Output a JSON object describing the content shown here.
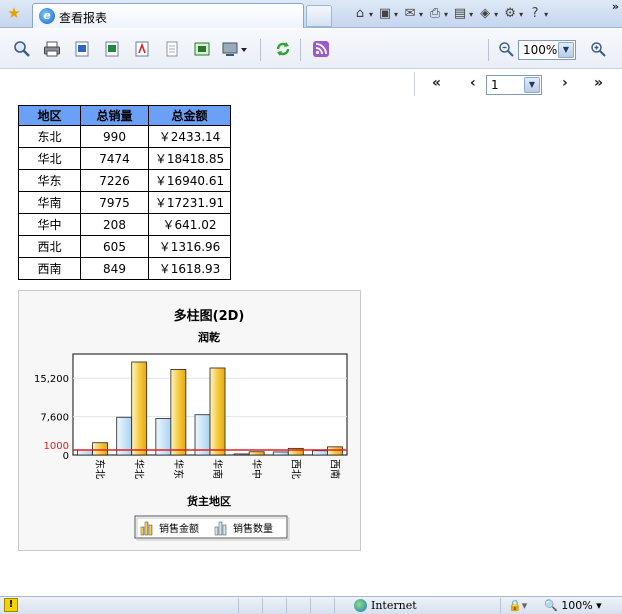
{
  "browser": {
    "tab_title": "查看报表",
    "ie_glyph": "e",
    "favorites_glyph": "★",
    "overflow_glyph": "»"
  },
  "commands": [
    {
      "name": "home-icon",
      "glyph": "⌂"
    },
    {
      "name": "feeds-icon",
      "glyph": "▣"
    },
    {
      "name": "mail-icon",
      "glyph": "✉"
    },
    {
      "name": "print-icon",
      "glyph": "⎙"
    },
    {
      "name": "page-icon",
      "glyph": "▤"
    },
    {
      "name": "safety-icon",
      "glyph": "◈"
    },
    {
      "name": "tools-icon",
      "glyph": "⚙"
    },
    {
      "name": "help-icon",
      "glyph": "?"
    }
  ],
  "toolbar": {
    "zoom_value": "100%",
    "zoom_out_glyph": "🔍",
    "zoom_in_glyph": "🔍"
  },
  "pager": {
    "first": "«",
    "prev": "‹",
    "page": "1",
    "next": "›",
    "last": "»"
  },
  "table": {
    "headers": [
      "地区",
      "总销量",
      "总金额"
    ],
    "rows": [
      [
        "东北",
        "990",
        "￥2433.14"
      ],
      [
        "华北",
        "7474",
        "￥18418.85"
      ],
      [
        "华东",
        "7226",
        "￥16940.61"
      ],
      [
        "华南",
        "7975",
        "￥17231.91"
      ],
      [
        "华中",
        "208",
        "￥641.02"
      ],
      [
        "西北",
        "605",
        "￥1316.96"
      ],
      [
        "西南",
        "849",
        "￥1618.93"
      ]
    ]
  },
  "chart_data": {
    "type": "bar",
    "title": "多柱图(2D)",
    "subtitle": "润乾",
    "xlabel": "货主地区",
    "ylabel": "",
    "categories": [
      "东北",
      "华北",
      "华东",
      "华南",
      "华中",
      "西北",
      "西南"
    ],
    "series": [
      {
        "name": "销售数量",
        "values": [
          990,
          7474,
          7226,
          7975,
          208,
          605,
          849
        ],
        "color": "#b9dcf5"
      },
      {
        "name": "销售金额",
        "values": [
          2433.14,
          18418.85,
          16940.61,
          17231.91,
          641.02,
          1316.96,
          1618.93
        ],
        "color": "#f2b81f"
      }
    ],
    "y_ticks": [
      "0",
      "7,600",
      "15,200"
    ],
    "y_tick_values": [
      0,
      7600,
      15200
    ],
    "ylim": [
      0,
      20000
    ],
    "reference_line": {
      "value": 1000,
      "label": "1000",
      "color": "#e02020"
    },
    "legend": [
      {
        "name": "销售金额",
        "color": "#f2b81f"
      },
      {
        "name": "销售数量",
        "color": "#b9dcf5"
      }
    ],
    "legend_position": "bottom",
    "grid": true
  },
  "statusbar": {
    "warning_glyph": "!",
    "zone": "Internet",
    "zoom": "100%",
    "zoom_icon": "🔍",
    "zoom_dropdown": "▾",
    "protected_glyph": "🔒▾"
  }
}
